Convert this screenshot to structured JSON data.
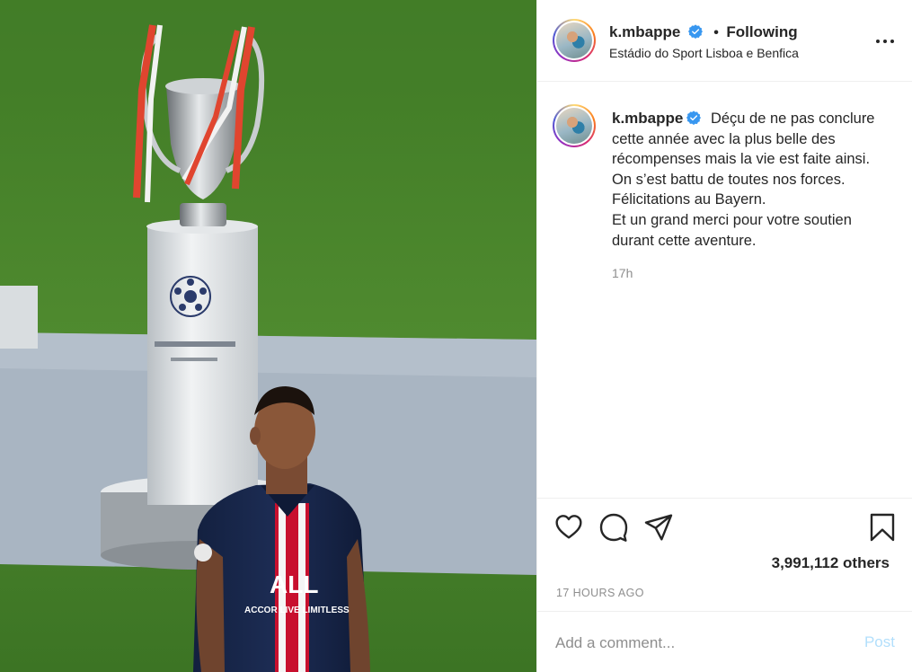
{
  "post": {
    "username": "k.mbappe",
    "follow_state": "Following",
    "separator": "•",
    "location": "Estádio do Sport Lisboa e Benfica",
    "caption": {
      "first_line": "Déçu de ne pas conclure",
      "lines": [
        "cette année avec la plus belle des",
        "récompenses mais la vie est faite ainsi.",
        "On s’est battu de toutes nos forces.",
        "Félicitations au Bayern.",
        "Et un grand merci pour votre soutien",
        "durant cette aventure."
      ]
    },
    "relative_time": "17h",
    "likes_text": "3,991,112 others",
    "posted_time": "17 HOURS AGO"
  },
  "comment": {
    "placeholder": "Add a comment...",
    "post_label": "Post"
  },
  "icons": {
    "verified": "verified-badge-icon",
    "more": "more-options-icon",
    "like": "heart-icon",
    "comment": "comment-icon",
    "share": "paper-plane-icon",
    "save": "bookmark-icon"
  },
  "colors": {
    "verified_blue": "#3897f0",
    "post_button_disabled": "#b2dffc",
    "secondary_text": "#8e8e8e",
    "text": "#262626"
  }
}
